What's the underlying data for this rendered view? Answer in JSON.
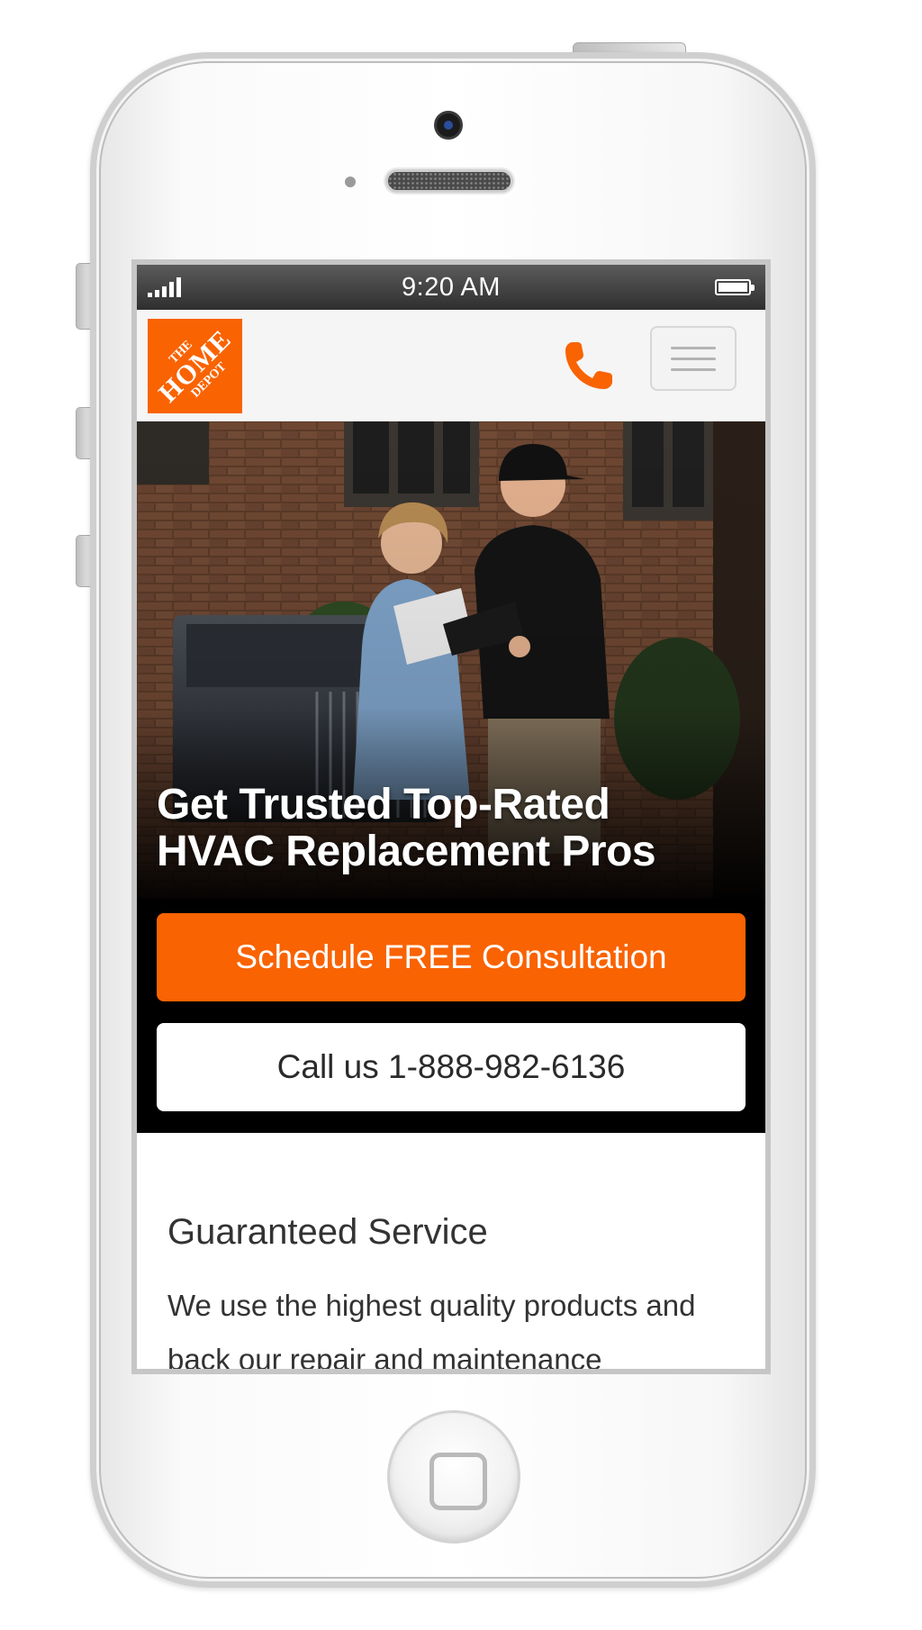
{
  "status_bar": {
    "time": "9:20 AM",
    "signal_icon": "signal-bars-icon",
    "battery_icon": "battery-icon"
  },
  "header": {
    "logo": {
      "line1": "THE",
      "line2": "HOME",
      "line3": "DEPOT",
      "color": "#f96302"
    },
    "call_icon": "phone-icon",
    "menu_icon": "hamburger-menu-icon"
  },
  "hero": {
    "title_line1": "Get Trusted Top-Rated",
    "title_line2": "HVAC Replacement Pros",
    "primary_cta": "Schedule FREE Consultation",
    "secondary_cta": "Call us 1-888-982-6136",
    "accent_color": "#f96302"
  },
  "content": {
    "section_title": "Guaranteed Service",
    "section_body": "We use the highest quality products and back our repair and maintenance"
  }
}
